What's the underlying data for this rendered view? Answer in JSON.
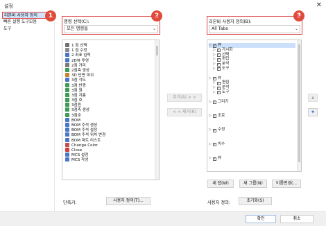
{
  "dialog": {
    "title": "설정",
    "close": "✕"
  },
  "sidebar": {
    "items": [
      {
        "label": "리본바 사용자 정의",
        "selected": true
      },
      {
        "label": "빠른 실행 도구모음",
        "selected": false
      },
      {
        "label": "도구",
        "selected": false
      }
    ]
  },
  "callouts": [
    "1",
    "2",
    "3"
  ],
  "left_panel": {
    "label": "명령 선택(C):",
    "combo_value": "모든 명령들",
    "combo_arrow": "⌄",
    "commands": [
      {
        "label": "1 점 선택",
        "icon": "#6f6f6f"
      },
      {
        "label": "1 점 수정",
        "icon": "#8a8a8a"
      },
      {
        "label": "2 좌표 입력",
        "icon": "#4a76c8"
      },
      {
        "label": "2D뷰 투영",
        "icon": "#4a76c8"
      },
      {
        "label": "2점 거리",
        "icon": "#7a7a7a"
      },
      {
        "label": "2점측 생성",
        "icon": "#3e9a55"
      },
      {
        "label": "3D 단면 파괴",
        "icon": "#c8842a"
      },
      {
        "label": "3점 각도",
        "icon": "#4a76c8"
      },
      {
        "label": "3점 반경",
        "icon": "#3e9a55"
      },
      {
        "label": "3점 원",
        "icon": "#3e9a55"
      },
      {
        "label": "3점 지름",
        "icon": "#3e9a55"
      },
      {
        "label": "3점 호",
        "icon": "#3e9a55"
      },
      {
        "label": "3점원",
        "icon": "#3e9a55"
      },
      {
        "label": "3점측 생성",
        "icon": "#3e9a55"
      },
      {
        "label": "3점호",
        "icon": "#3e9a55"
      },
      {
        "label": "BOM",
        "icon": "#4a76c8"
      },
      {
        "label": "BOM 주석 생성",
        "icon": "#4a76c8"
      },
      {
        "label": "BOM 주석 설정",
        "icon": "#4a76c8"
      },
      {
        "label": "BOM 주석 위치 변경",
        "icon": "#4a76c8"
      },
      {
        "label": "BOM 파트 리스트",
        "icon": "#4a76c8"
      },
      {
        "label": "Change Color",
        "icon": "#c84a4a"
      },
      {
        "label": "Close",
        "icon": "#d23c3c"
      },
      {
        "label": "MCS 설정",
        "icon": "#4a76c8"
      },
      {
        "label": "MCS 작성",
        "icon": "#4a76c8"
      }
    ]
  },
  "middle_buttons": {
    "add": "추가(A) > >",
    "remove": "< < 제거(R)"
  },
  "right_panel": {
    "label": "리본바 사용자 정의(B):",
    "combo_value": "All Tabs",
    "combo_arrow": "⌄",
    "tree": [
      {
        "label": "뷰",
        "level": 0,
        "checked": true,
        "selected": true
      },
      {
        "label": "가시화",
        "level": 1,
        "checked": true,
        "selected": false
      },
      {
        "label": "선택",
        "level": 1,
        "checked": true,
        "selected": false
      },
      {
        "label": "편집",
        "level": 1,
        "checked": true,
        "selected": false
      },
      {
        "label": "분석",
        "level": 1,
        "checked": true,
        "selected": false
      },
      {
        "label": "도구",
        "level": 1,
        "checked": true,
        "selected": false
      },
      {
        "label": "",
        "level": 0,
        "checked": null,
        "selected": false
      },
      {
        "label": "뷰",
        "level": 0,
        "checked": true,
        "selected": false
      },
      {
        "label": "편집",
        "level": 1,
        "checked": true,
        "selected": false
      },
      {
        "label": "분석",
        "level": 1,
        "checked": true,
        "selected": false
      },
      {
        "label": "도구",
        "level": 1,
        "checked": true,
        "selected": false
      },
      {
        "label": "",
        "level": 0,
        "checked": null,
        "selected": false
      },
      {
        "label": "그리기",
        "level": 0,
        "checked": true,
        "selected": false
      },
      {
        "label": "",
        "level": 0,
        "checked": null,
        "selected": false
      },
      {
        "label": "",
        "level": 0,
        "checked": null,
        "selected": false
      },
      {
        "label": "조로",
        "level": 0,
        "checked": true,
        "selected": false
      },
      {
        "label": "",
        "level": 0,
        "checked": null,
        "selected": false
      },
      {
        "label": "",
        "level": 0,
        "checked": null,
        "selected": false
      },
      {
        "label": "수정",
        "level": 0,
        "checked": true,
        "selected": false
      },
      {
        "label": "",
        "level": 0,
        "checked": null,
        "selected": false
      },
      {
        "label": "",
        "level": 0,
        "checked": null,
        "selected": false
      },
      {
        "label": "치수",
        "level": 0,
        "checked": true,
        "selected": false
      },
      {
        "label": "",
        "level": 0,
        "checked": null,
        "selected": false
      },
      {
        "label": "",
        "level": 0,
        "checked": null,
        "selected": false
      },
      {
        "label": "뷰",
        "level": 0,
        "checked": true,
        "selected": false
      }
    ],
    "move_up": "▲",
    "move_down": "▼",
    "buttons": {
      "new_tab": "새 탭(W)",
      "new_group": "새 그룹(N)",
      "rename": "이름변경(..."
    }
  },
  "bottom": {
    "shortcut_label": "단축키:",
    "customize_button": "사용자 정의(T)...",
    "custom_label": "사용자 정의:",
    "reset_button": "초기화(S)"
  },
  "footer": {
    "ok": "확인",
    "cancel": "취소"
  },
  "colors": {
    "accent": "#e04b3c",
    "selection": "#cce0fb",
    "move_down": "#2f7fd6"
  }
}
